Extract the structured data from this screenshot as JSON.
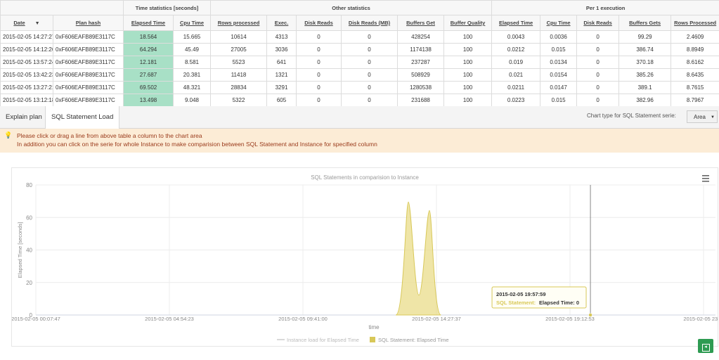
{
  "table": {
    "groups": [
      "Time statistics [seconds]",
      "Other statistics",
      "Per 1 execution"
    ],
    "columns": [
      "Date",
      "Plan hash",
      "Elapsed Time",
      "Cpu Time",
      "Rows processed",
      "Exec.",
      "Disk Reads",
      "Disk Reads (MB)",
      "Buffers Get",
      "Buffer Quality",
      "Elapsed Time",
      "Cpu Time",
      "Disk Reads",
      "Buffers Gets",
      "Rows Processed"
    ],
    "rows": [
      [
        "2015-02-05 14:27:27",
        "0xF606EAFB89E3117C",
        "18.564",
        "15.665",
        "10614",
        "4313",
        "0",
        "0",
        "428254",
        "100",
        "0.0043",
        "0.0036",
        "0",
        "99.29",
        "2.4609"
      ],
      [
        "2015-02-05 14:12:26",
        "0xF606EAFB89E3117C",
        "64.294",
        "45.49",
        "27005",
        "3036",
        "0",
        "0",
        "1174138",
        "100",
        "0.0212",
        "0.015",
        "0",
        "386.74",
        "8.8949"
      ],
      [
        "2015-02-05 13:57:24",
        "0xF606EAFB89E3117C",
        "12.181",
        "8.581",
        "5523",
        "641",
        "0",
        "0",
        "237287",
        "100",
        "0.019",
        "0.0134",
        "0",
        "370.18",
        "8.6162"
      ],
      [
        "2015-02-05 13:42:23",
        "0xF606EAFB89E3117C",
        "27.687",
        "20.381",
        "11418",
        "1321",
        "0",
        "0",
        "508929",
        "100",
        "0.021",
        "0.0154",
        "0",
        "385.26",
        "8.6435"
      ],
      [
        "2015-02-05 13:27:21",
        "0xF606EAFB89E3117C",
        "69.502",
        "48.321",
        "28834",
        "3291",
        "0",
        "0",
        "1280538",
        "100",
        "0.0211",
        "0.0147",
        "0",
        "389.1",
        "8.7615"
      ],
      [
        "2015-02-05 13:12:18",
        "0xF606EAFB89E3117C",
        "13.498",
        "9.048",
        "5322",
        "605",
        "0",
        "0",
        "231688",
        "100",
        "0.0223",
        "0.015",
        "0",
        "382.96",
        "8.7967"
      ]
    ]
  },
  "tabs": [
    {
      "label": "Explain plan",
      "active": false
    },
    {
      "label": "SQL Statement Load",
      "active": true
    }
  ],
  "chart_type": {
    "label": "Chart type for SQL Statement serie:",
    "value": "Area"
  },
  "notice": {
    "line1": "Please click or drag a line from above table a column to the chart area",
    "line2": "In addition you can click on the serie for whole Instance to make comparision between SQL Statement and Instance for specified column"
  },
  "chart_data": {
    "type": "area",
    "title": "SQL Statements in comparision to Instance",
    "xlabel": "time",
    "ylabel": "Elapsed Time [seconds]",
    "ylim": [
      0,
      80
    ],
    "yticks": [
      0,
      20,
      40,
      60,
      80
    ],
    "xticks": [
      "2015-02-05 00:07:47",
      "2015-02-05 04:54:23",
      "2015-02-05 09:41:00",
      "2015-02-05 14:27:37",
      "2015-02-05 19:12:53",
      "2015-02-05 23:..."
    ],
    "grid": true,
    "legend": "bottom-center",
    "series": [
      {
        "name": "Instance load for Elapsed Time",
        "color": "#cccccc",
        "x": [],
        "y": []
      },
      {
        "name": "SQL Statement: Elapsed Time",
        "color": "#d8c858",
        "x": [
          "2015-02-05 13:12:18",
          "2015-02-05 13:27:21",
          "2015-02-05 13:42:23",
          "2015-02-05 13:57:24",
          "2015-02-05 14:12:26",
          "2015-02-05 14:27:27"
        ],
        "y": [
          13.498,
          69.502,
          27.687,
          12.181,
          64.294,
          18.564
        ]
      }
    ],
    "tooltip": {
      "date": "2015-02-05 19:57:59",
      "series": "SQL Statement:",
      "metric": "Elapsed Time: 0"
    }
  },
  "colors": {
    "highlight_column": "#a8e0c6",
    "notice_bg": "#fcecd6",
    "notice_text": "#9a3a1b",
    "area_fill": "#e9dc8a",
    "area_stroke": "#d8c858",
    "export_button": "#2e9b52"
  },
  "icons": {
    "sort": "sort-down-icon",
    "notice": "lightbulb-icon",
    "menu": "hamburger-menu-icon",
    "export": "export-icon"
  }
}
